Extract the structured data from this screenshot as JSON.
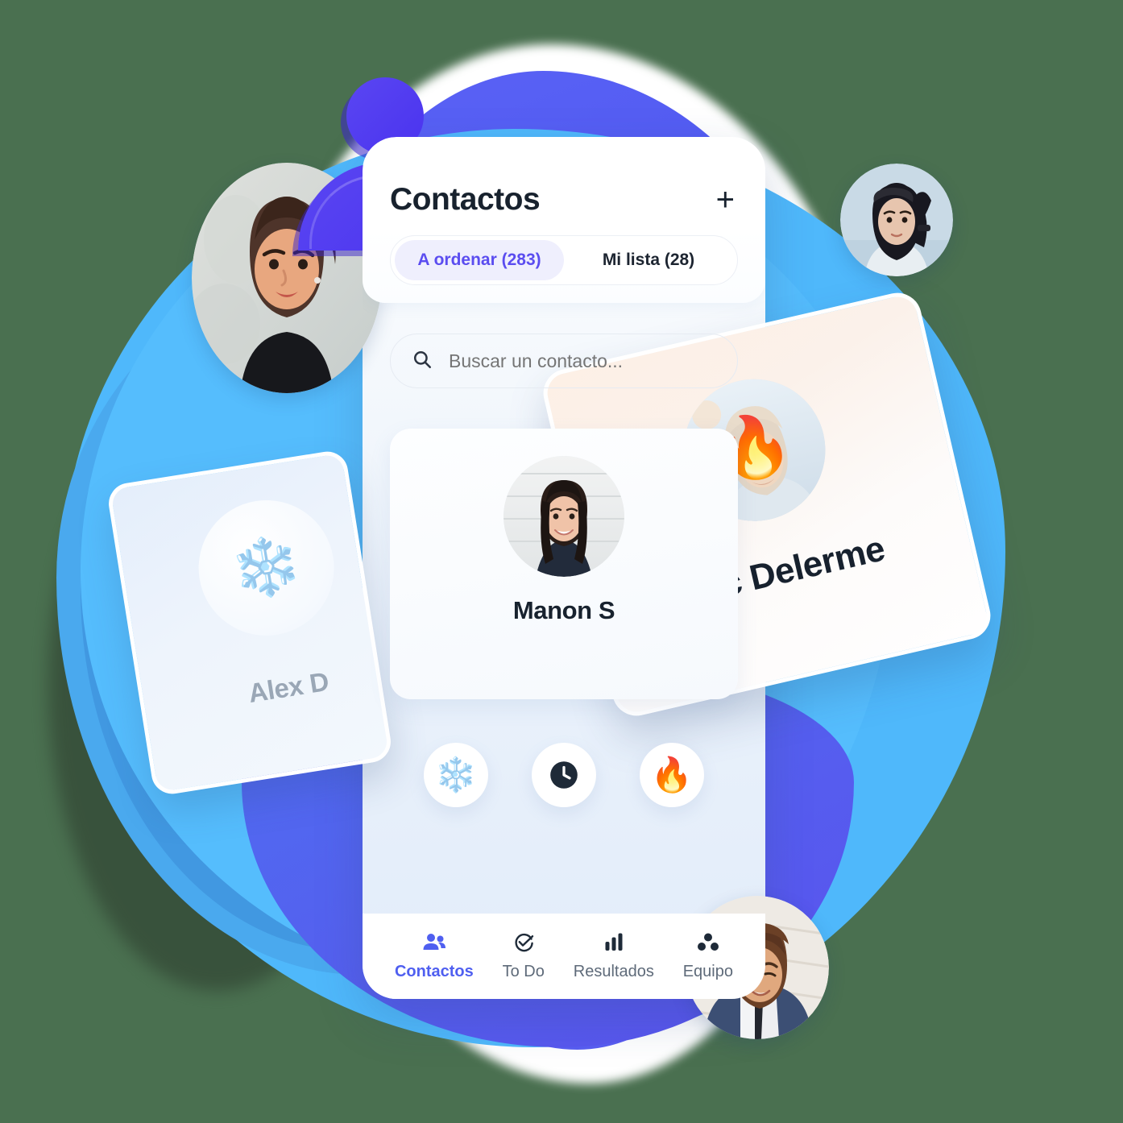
{
  "background": {
    "page_color": "#4a7050",
    "blob_colors": [
      "#4fb8fb",
      "#3f8fd8",
      "#5656ee",
      "#5b63f5",
      "#ffffff"
    ]
  },
  "app": {
    "header": {
      "title": "Contactos",
      "add_button": "+",
      "add_icon": "plus-icon"
    },
    "tabs": [
      {
        "label": "A ordenar (283)",
        "active": true
      },
      {
        "label": "Mi lista (28)",
        "active": false
      }
    ],
    "search": {
      "placeholder": "Buscar un contacto...",
      "value": "",
      "icon": "search-icon"
    },
    "contact_card": {
      "name": "Manon S",
      "avatar": "manon-photo"
    },
    "actions": [
      {
        "name": "cold-action",
        "icon": "snowflake-icon",
        "glyph": "❄️"
      },
      {
        "name": "later-action",
        "icon": "clock-icon",
        "glyph": "🕐"
      },
      {
        "name": "hot-action",
        "icon": "fire-icon",
        "glyph": "🔥"
      }
    ],
    "bottom_nav": [
      {
        "label": "Contactos",
        "icon": "people-icon",
        "active": true
      },
      {
        "label": "To Do",
        "icon": "check-circle-icon",
        "active": false
      },
      {
        "label": "Resultados",
        "icon": "bar-chart-icon",
        "active": false
      },
      {
        "label": "Equipo",
        "icon": "team-dots-icon",
        "active": false
      }
    ]
  },
  "floating_cards": {
    "alex": {
      "name": "Alex D",
      "icon": "snowflake-icon",
      "glyph": "❄️",
      "accent": "#e4eefb"
    },
    "luc": {
      "name": "Luc Delerme",
      "icon": "fire-icon",
      "glyph": "🔥",
      "accent": "#fdf0e6"
    }
  },
  "floating_avatars": [
    {
      "name": "avatar-woman-top-left"
    },
    {
      "name": "avatar-woman-top-right"
    },
    {
      "name": "avatar-man-bottom-right"
    }
  ],
  "person_badge": {
    "name": "person-icon",
    "color": "#4a33ef"
  },
  "colors": {
    "accent_indigo": "#4f5ff0",
    "tab_active_text": "#5b4df0",
    "tab_active_bg": "#efeffd",
    "text_dark": "#18222e",
    "text_muted": "#5e6a79",
    "sky": "#4fb8fb"
  }
}
